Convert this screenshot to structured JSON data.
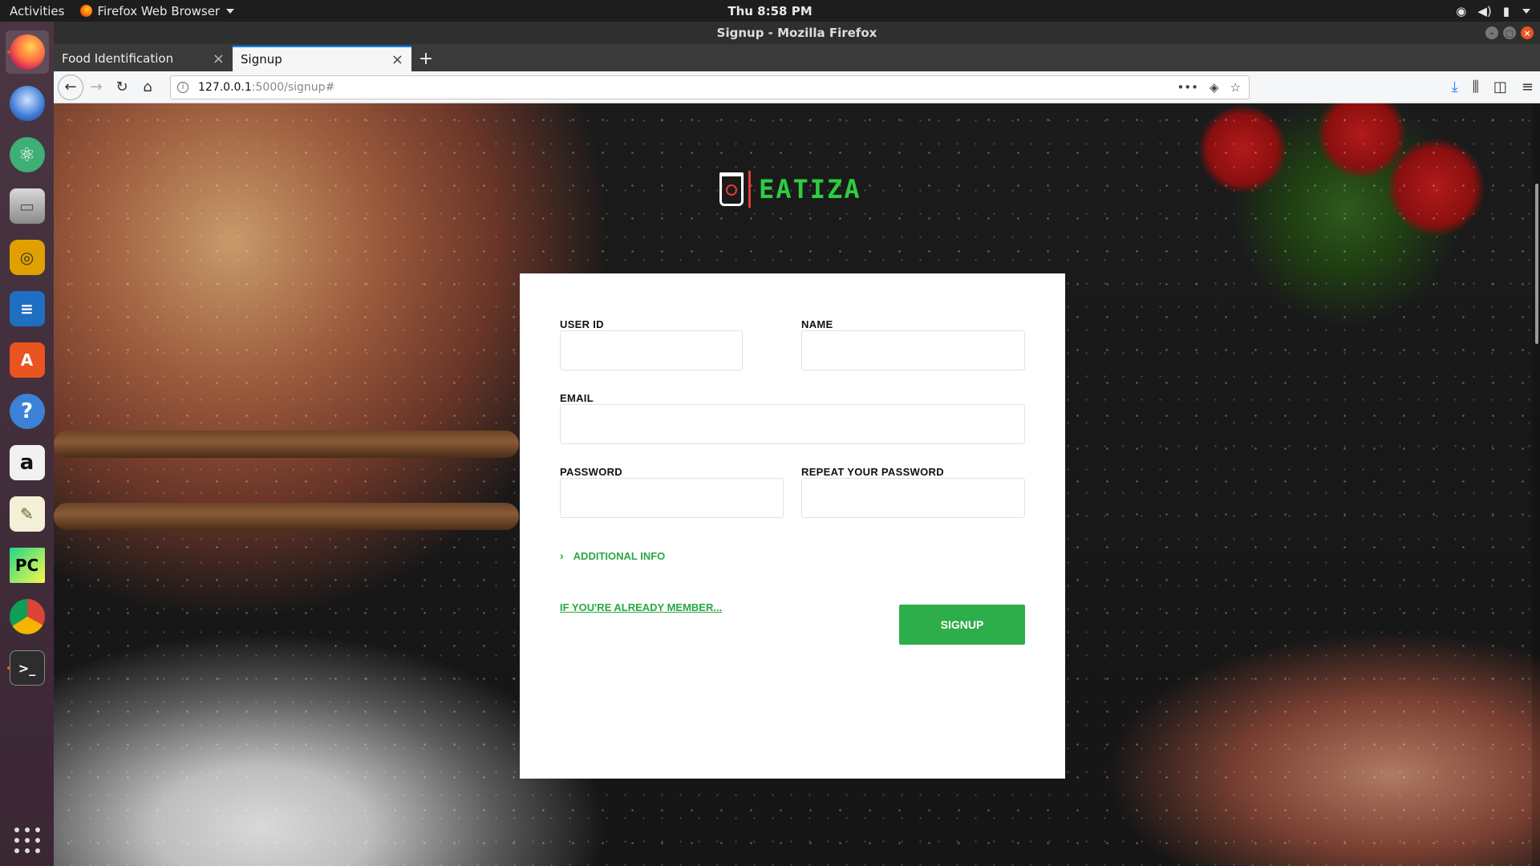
{
  "system": {
    "activities": "Activities",
    "app_menu": "Firefox Web Browser",
    "clock": "Thu  8:58 PM"
  },
  "window": {
    "title": "Signup - Mozilla Firefox"
  },
  "tabs": [
    {
      "label": "Food Identification"
    },
    {
      "label": "Signup"
    }
  ],
  "address": {
    "host": "127.0.0.1",
    "path": ":5000/signup#"
  },
  "brand": {
    "name": "EATIZA",
    "color": "#2ecc40"
  },
  "form": {
    "user_id_label": "USER ID",
    "name_label": "NAME",
    "email_label": "EMAIL",
    "password_label": "PASSWORD",
    "repeat_password_label": "REPEAT YOUR PASSWORD",
    "additional_info": "ADDITIONAL INFO",
    "member_link": "IF YOU'RE ALREADY MEMBER...",
    "submit": "SIGNUP",
    "user_id_value": "",
    "name_value": "",
    "email_value": "",
    "password_value": "",
    "repeat_password_value": ""
  },
  "dock": [
    {
      "icon": "firefox-icon"
    },
    {
      "icon": "thunderbird-icon"
    },
    {
      "icon": "atom-icon"
    },
    {
      "icon": "files-icon"
    },
    {
      "icon": "rhythmbox-icon"
    },
    {
      "icon": "writer-icon"
    },
    {
      "icon": "software-icon"
    },
    {
      "icon": "help-icon"
    },
    {
      "icon": "amazon-icon"
    },
    {
      "icon": "text-editor-icon"
    },
    {
      "icon": "pycharm-icon"
    },
    {
      "icon": "chrome-icon"
    },
    {
      "icon": "terminal-icon"
    }
  ],
  "colors": {
    "accent_green": "#2ead4b",
    "firefox_blue": "#0a84ff",
    "ubuntu_orange": "#e95420"
  }
}
